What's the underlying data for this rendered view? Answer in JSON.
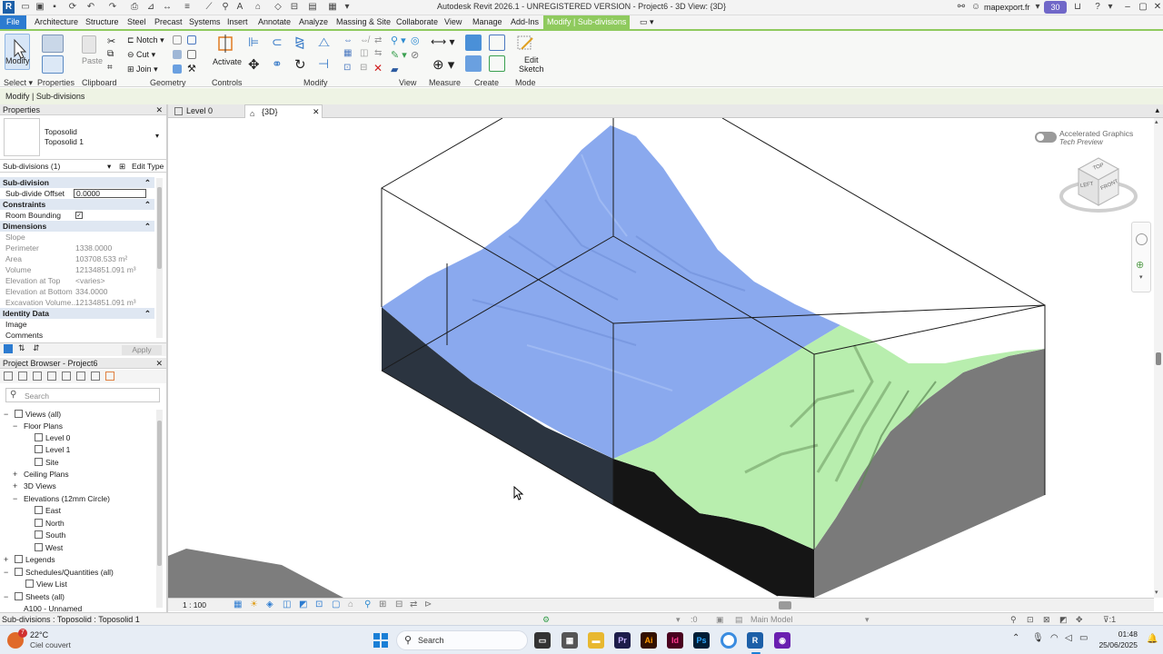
{
  "app": {
    "title": "Autodesk Revit 2026.1 - UNREGISTERED VERSION - Project6 - 3D View: {3D}",
    "logo_letter": "R",
    "user": "mapexport.fr",
    "badge_count": "30"
  },
  "menu": {
    "tabs": [
      "File",
      "Architecture",
      "Structure",
      "Steel",
      "Precast",
      "Systems",
      "Insert",
      "Annotate",
      "Analyze",
      "Massing & Site",
      "Collaborate",
      "View",
      "Manage",
      "Add-Ins",
      "Modify | Sub-divisions"
    ]
  },
  "ribbon": {
    "modify_label": "Modify",
    "paste_label": "Paste",
    "notch_label": "Notch",
    "cut_label": "Cut",
    "join_label": "Join",
    "activate_label": "Activate",
    "edit_sketch_label": "Edit\nSketch",
    "edit_label": "Edit",
    "sketch_label": "Sketch",
    "panels": {
      "select": "Select",
      "properties": "Properties",
      "clipboard": "Clipboard",
      "geometry": "Geometry",
      "controls": "Controls",
      "modify": "Modify",
      "view": "View",
      "measure": "Measure",
      "create": "Create",
      "mode": "Mode"
    }
  },
  "options_bar": "Modify | Sub-divisions",
  "properties": {
    "header": "Properties",
    "type_family": "Toposolid",
    "type_name": "Toposolid 1",
    "selector": "Sub-divisions (1)",
    "edit_type": "Edit Type",
    "sections": {
      "subdivision": "Sub-division",
      "constraints": "Constraints",
      "dimensions": "Dimensions",
      "identity": "Identity Data"
    },
    "rows": {
      "subdivide_offset": {
        "k": "Sub-divide Offset",
        "v": "0.0000"
      },
      "room_bounding": {
        "k": "Room Bounding"
      },
      "slope": {
        "k": "Slope",
        "v": ""
      },
      "perimeter": {
        "k": "Perimeter",
        "v": "1338.0000"
      },
      "area": {
        "k": "Area",
        "v": "103708.533 m²"
      },
      "volume": {
        "k": "Volume",
        "v": "12134851.091 m³"
      },
      "elev_top": {
        "k": "Elevation at Top",
        "v": "<varies>"
      },
      "elev_bottom": {
        "k": "Elevation at Bottom",
        "v": "334.0000"
      },
      "excavation": {
        "k": "Excavation Volume...",
        "v": "12134851.091 m³"
      },
      "image": {
        "k": "Image"
      },
      "comments": {
        "k": "Comments"
      }
    },
    "apply": "Apply"
  },
  "project_browser": {
    "header": "Project Browser - Project6",
    "search_placeholder": "Search",
    "items": {
      "views_all": "Views (all)",
      "floor_plans": "Floor Plans",
      "level0": "Level 0",
      "level1": "Level 1",
      "site": "Site",
      "ceiling_plans": "Ceiling Plans",
      "views3d": "3D Views",
      "elevations": "Elevations (12mm Circle)",
      "east": "East",
      "north": "North",
      "south": "South",
      "west": "West",
      "legends": "Legends",
      "schedules": "Schedules/Quantities (all)",
      "view_list": "View List",
      "sheets": "Sheets (all)",
      "a100": "A100 - Unnamed"
    }
  },
  "view_tabs": [
    "Level 0",
    "{3D}"
  ],
  "viewport": {
    "accel_title": "Accelerated Graphics",
    "accel_sub": "Tech Preview",
    "cube": {
      "top": "TOP",
      "left": "LEFT",
      "front": "FRONT"
    }
  },
  "view_control": {
    "scale": "1 : 100"
  },
  "status": {
    "text": "Sub-divisions : Toposolid : Toposolid 1",
    "zero": ":0",
    "model": "Main Model",
    "filter": ":1"
  },
  "taskbar": {
    "weather_temp": "22°C",
    "weather_desc": "Ciel couvert",
    "weather_badge": "7",
    "search": "Search",
    "time": "01:48",
    "date": "25/06/2025"
  },
  "colors": {
    "accent_blue": "#2c7bd0",
    "context_green": "#8fca5e",
    "terrain_blue": "#8aa9ee",
    "terrain_green": "#b8eeae",
    "side_dark": "#2b3440",
    "side_grey": "#7a7a7a"
  }
}
